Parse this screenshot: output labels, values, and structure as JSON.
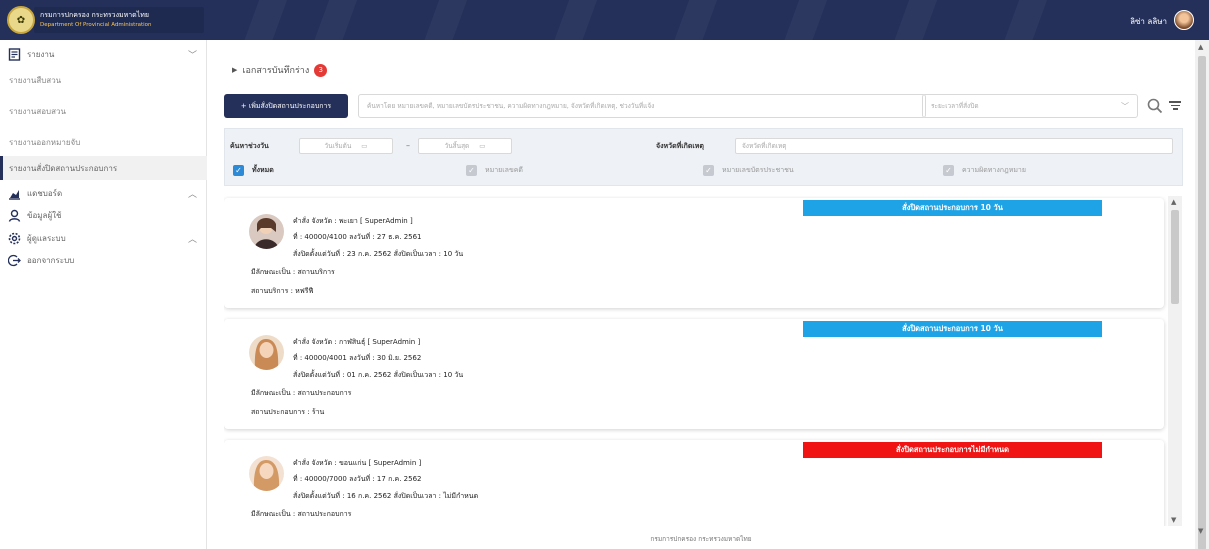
{
  "header": {
    "org_th": "กรมการปกครอง กระทรวงมหาดไทย",
    "org_en": "Department Of Provincial Administration",
    "user_name": "ลิซ่า ลลิษา"
  },
  "sidebar": {
    "sections": [
      {
        "label": "รายงาน",
        "icon": "report-icon",
        "expanded": true
      },
      {
        "label": "แดชบอร์ด",
        "icon": "chart-icon",
        "expanded": false
      },
      {
        "label": "ข้อมูลผู้ใช้",
        "icon": "user-icon"
      },
      {
        "label": "ผู้ดูแลระบบ",
        "icon": "gear-icon",
        "expanded": false
      },
      {
        "label": "ออกจากระบบ",
        "icon": "logout-icon"
      }
    ],
    "report_items": [
      {
        "label": "รายงานสืบสวน"
      },
      {
        "label": "รายงานสอบสวน"
      },
      {
        "label": "รายงานออกหมายจับ"
      },
      {
        "label": "รายงานสั่งปิดสถานประกอบการ",
        "active": true
      }
    ]
  },
  "breadcrumb": {
    "label": "เอกสารบันทึกร่าง",
    "count": "3"
  },
  "toolbar": {
    "add_label": "+ เพิ่มสั่งปิดสถานประกอบการ",
    "search_placeholder": "ค้นหาโดย หมายเลขคดี, หมายเลขบัตรประชาชน, ความผิดทางกฎหมาย, จังหวัดที่เกิดเหตุ, ช่วงวันที่แจ้ง",
    "period_placeholder": "ระยะเวลาที่สั่งปิด"
  },
  "filters": {
    "date_range_label": "ค้นหาช่วงวัน",
    "start_placeholder": "วันเริ่มต้น",
    "end_placeholder": "วันสิ้นสุด",
    "province_label": "จังหวัดที่เกิดเหตุ",
    "province_placeholder": "จังหวัดที่เกิดเหตุ",
    "checkboxes": [
      {
        "label": "ทั้งหมด",
        "checked": true
      },
      {
        "label": "หมายเลขคดี",
        "checked": false
      },
      {
        "label": "หมายเลขบัตรประชาชน",
        "checked": false
      },
      {
        "label": "ความผิดทางกฎหมาย",
        "checked": false
      }
    ]
  },
  "cards": [
    {
      "ribbon": "สั่งปิดสถานประกอบการ 10 วัน",
      "ribbon_color": "#1ea4e6",
      "order": "คำสั่ง จังหวัด : พะเยา [ SuperAdmin ]",
      "number": "ที่ : 40000/4100 ลงวันที่ : 27 ธ.ค. 2561",
      "close_info": "สั่งปิดตั้งแต่วันที่ : 23 ก.ค. 2562 สั่งปิดเป็นเวลา : 10 วัน",
      "type": "มีลักษณะเป็น : สถานบริการ",
      "venue": "สถานบริการ : หฟรีฟี"
    },
    {
      "ribbon": "สั่งปิดสถานประกอบการ 10 วัน",
      "ribbon_color": "#1ea4e6",
      "order": "คำสั่ง จังหวัด : กาฬสินธุ์ [ SuperAdmin ]",
      "number": "ที่ : 40000/4001 ลงวันที่ : 30 มิ.ย. 2562",
      "close_info": "สั่งปิดตั้งแต่วันที่ : 01 ก.ค. 2562 สั่งปิดเป็นเวลา : 10 วัน",
      "type": "มีลักษณะเป็น : สถานประกอบการ",
      "venue": "สถานประกอบการ : ร้าน"
    },
    {
      "ribbon": "สั่งปิดสถานประกอบการไม่มีกำหนด",
      "ribbon_color": "#f01414",
      "order": "คำสั่ง จังหวัด : ขอนแก่น [ SuperAdmin ]",
      "number": "ที่ : 40000/7000 ลงวันที่ : 17 ก.ค. 2562",
      "close_info": "สั่งปิดตั้งแต่วันที่ : 16 ก.ค. 2562 สั่งปิดเป็นเวลา : ไม่มีกำหนด",
      "type": "มีลักษณะเป็น : สถานประกอบการ",
      "venue": ""
    }
  ],
  "footer": {
    "text": "กรมการปกครอง กระทรวงมหาดไทย"
  }
}
